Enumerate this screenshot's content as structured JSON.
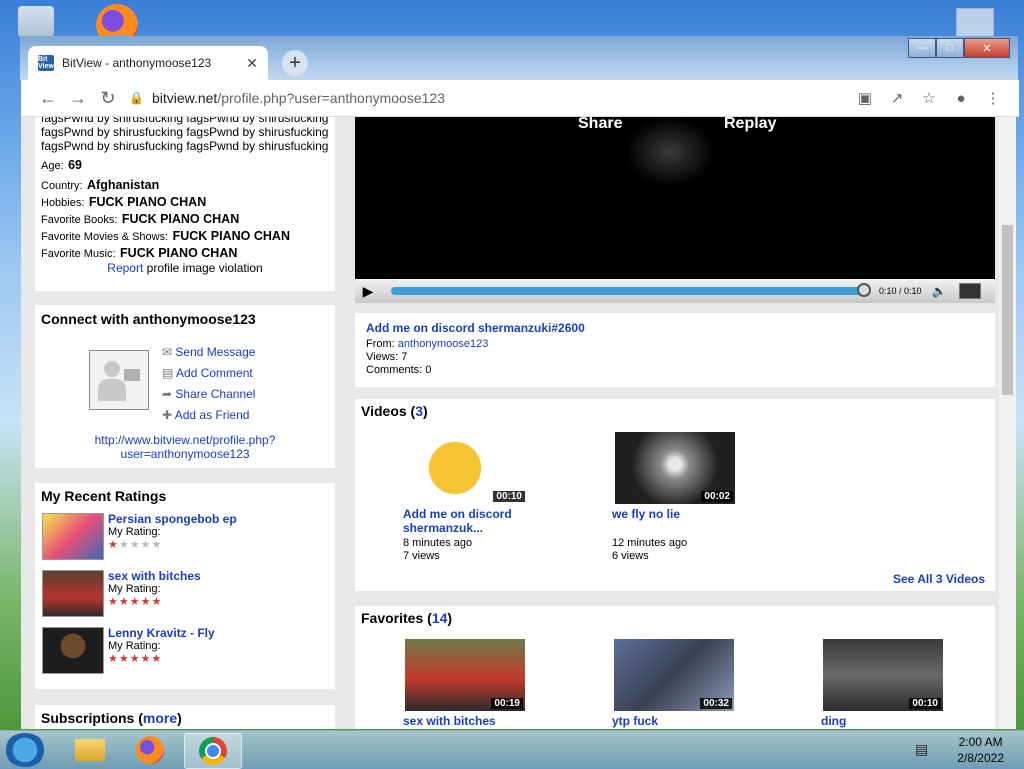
{
  "browser": {
    "tab_title": "BitView - anthonymoose123",
    "favicon_label": "Bit View",
    "url_host": "bitview.net",
    "url_path": "/profile.php?user=anthonymoose123"
  },
  "profile": {
    "bio_lines": [
      "fagsPwnd by shirusfucking fagsPwnd by shirusfucking",
      "fagsPwnd by shirusfucking fagsPwnd by shirusfucking",
      "fagsPwnd by shirusfucking fagsPwnd by shirusfucking"
    ],
    "age_label": "Age:",
    "age": "69",
    "fields": [
      {
        "label": "Country:",
        "value": "Afghanistan"
      },
      {
        "label": "Hobbies:",
        "value": "FUCK PIANO CHAN"
      },
      {
        "label": "Favorite Books:",
        "value": "FUCK PIANO CHAN"
      },
      {
        "label": "Favorite Movies & Shows:",
        "value": "FUCK PIANO CHAN"
      },
      {
        "label": "Favorite Music:",
        "value": "FUCK PIANO CHAN"
      }
    ],
    "report_link": "Report",
    "report_text": "profile image violation"
  },
  "connect": {
    "title": "Connect with anthonymoose123",
    "actions": [
      "Send Message",
      "Add Comment",
      "Share Channel",
      "Add as Friend"
    ],
    "url_line1": "http://www.bitview.net/profile.php?",
    "url_line2": "user=anthonymoose123"
  },
  "ratings": {
    "title": "My Recent Ratings",
    "rating_label": "My Rating:",
    "items": [
      {
        "title": "Persian spongebob ep",
        "stars": 1
      },
      {
        "title": "sex with bitches",
        "stars": 5
      },
      {
        "title": "Lenny Kravitz - Fly",
        "stars": 5
      }
    ]
  },
  "subscriptions": {
    "title": "Subscriptions",
    "more": "more"
  },
  "player": {
    "share": "Share",
    "replay": "Replay",
    "time": "0:10 / 0:10",
    "progress": 1.0
  },
  "video_info": {
    "title": "Add me on discord shermanzuki#2600",
    "from_label": "From:",
    "from": "anthonymoose123",
    "views": "Views: 7",
    "comments": "Comments: 0"
  },
  "videos": {
    "title": "Videos",
    "count": "3",
    "see_all": "See All 3 Videos",
    "items": [
      {
        "title1": "Add me on discord",
        "title2": "shermanzuk...",
        "duration": "00:10",
        "ago": "8 minutes ago",
        "views": "7 views"
      },
      {
        "title1": "we fly no lie",
        "title2": "",
        "duration": "00:02",
        "ago": "12 minutes ago",
        "views": "6 views"
      }
    ]
  },
  "favorites": {
    "title": "Favorites",
    "count": "14",
    "items": [
      {
        "title": "sex with bitches",
        "duration": "00:19"
      },
      {
        "title": "ytp fuck",
        "duration": "00:32"
      },
      {
        "title": "ding",
        "duration": "00:10"
      }
    ]
  },
  "taskbar": {
    "time": "2:00 AM",
    "date": "2/8/2022"
  }
}
